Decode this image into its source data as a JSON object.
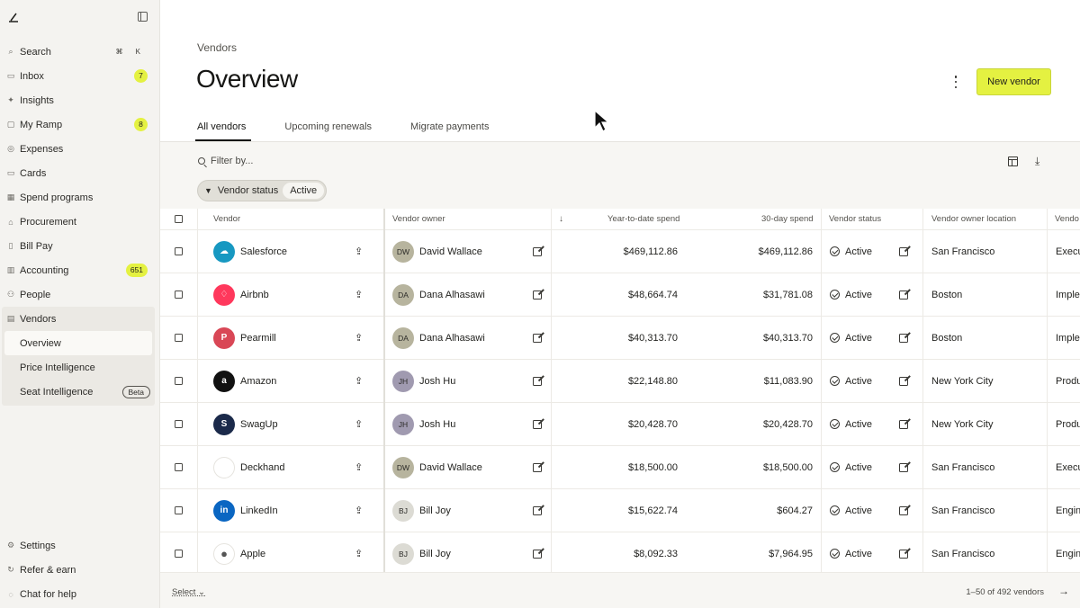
{
  "sidebar": {
    "items": [
      {
        "label": "Search",
        "icon": "search-icon",
        "shortcut": "⌘ K"
      },
      {
        "label": "Inbox",
        "icon": "inbox-icon",
        "badge": "7"
      },
      {
        "label": "Insights",
        "icon": "insights-icon"
      },
      {
        "label": "My Ramp",
        "icon": "my-ramp-icon",
        "badge": "8"
      },
      {
        "label": "Expenses",
        "icon": "expenses-icon"
      },
      {
        "label": "Cards",
        "icon": "cards-icon"
      },
      {
        "label": "Spend programs",
        "icon": "spend-programs-icon"
      },
      {
        "label": "Procurement",
        "icon": "procurement-icon"
      },
      {
        "label": "Bill Pay",
        "icon": "bill-pay-icon"
      },
      {
        "label": "Accounting",
        "icon": "accounting-icon",
        "badge": "651"
      },
      {
        "label": "People",
        "icon": "people-icon"
      }
    ],
    "vendors": {
      "label": "Vendors",
      "sub": [
        {
          "label": "Overview"
        },
        {
          "label": "Price Intelligence"
        },
        {
          "label": "Seat Intelligence",
          "tag": "Beta"
        }
      ]
    },
    "bottom": [
      {
        "label": "Settings",
        "icon": "gear-icon"
      },
      {
        "label": "Refer & earn",
        "icon": "refer-icon"
      },
      {
        "label": "Chat for help",
        "icon": "help-icon"
      }
    ]
  },
  "header": {
    "breadcrumb": "Vendors",
    "title": "Overview",
    "new_vendor": "New vendor"
  },
  "tabs": [
    "All vendors",
    "Upcoming renewals",
    "Migrate payments"
  ],
  "filter": {
    "placeholder": "Filter by...",
    "chip_label": "Vendor status",
    "chip_value": "Active"
  },
  "columns": {
    "vendor": "Vendor",
    "owner": "Vendor owner",
    "ytd": "Year-to-date spend",
    "spend30": "30-day spend",
    "status": "Vendor status",
    "location": "Vendor owner location",
    "extra": "Vendo"
  },
  "rows": [
    {
      "vendor": "Salesforce",
      "initials": "DW",
      "owner": "David Wallace",
      "ytd": "$469,112.86",
      "spend30": "$469,112.86",
      "status": "Active",
      "location": "San Francisco",
      "extra": "Execu",
      "logo": "salesforce",
      "avatar_color": "#b7b49e"
    },
    {
      "vendor": "Airbnb",
      "initials": "DA",
      "owner": "Dana Alhasawi",
      "ytd": "$48,664.74",
      "spend30": "$31,781.08",
      "status": "Active",
      "location": "Boston",
      "extra": "Imple",
      "logo": "airbnb",
      "avatar_color": "#b7b49e"
    },
    {
      "vendor": "Pearmill",
      "initials": "DA",
      "owner": "Dana Alhasawi",
      "ytd": "$40,313.70",
      "spend30": "$40,313.70",
      "status": "Active",
      "location": "Boston",
      "extra": "Imple",
      "logo": "pearmill",
      "avatar_color": "#b7b49e"
    },
    {
      "vendor": "Amazon",
      "initials": "JH",
      "owner": "Josh Hu",
      "ytd": "$22,148.80",
      "spend30": "$11,083.90",
      "status": "Active",
      "location": "New York City",
      "extra": "Produ",
      "logo": "amazon",
      "avatar_color": "#a09ab0"
    },
    {
      "vendor": "SwagUp",
      "initials": "JH",
      "owner": "Josh Hu",
      "ytd": "$20,428.70",
      "spend30": "$20,428.70",
      "status": "Active",
      "location": "New York City",
      "extra": "Produ",
      "logo": "swagup",
      "avatar_color": "#a09ab0"
    },
    {
      "vendor": "Deckhand",
      "initials": "DW",
      "owner": "David Wallace",
      "ytd": "$18,500.00",
      "spend30": "$18,500.00",
      "status": "Active",
      "location": "San Francisco",
      "extra": "Execu",
      "logo": "deckhand",
      "avatar_color": "#b7b49e"
    },
    {
      "vendor": "LinkedIn",
      "initials": "BJ",
      "owner": "Bill Joy",
      "ytd": "$15,622.74",
      "spend30": "$604.27",
      "status": "Active",
      "location": "San Francisco",
      "extra": "Engin",
      "logo": "linkedin",
      "avatar_color": "#dcdbd4"
    },
    {
      "vendor": "Apple",
      "initials": "BJ",
      "owner": "Bill Joy",
      "ytd": "$8,092.33",
      "spend30": "$7,964.95",
      "status": "Active",
      "location": "San Francisco",
      "extra": "Engin",
      "logo": "apple",
      "avatar_color": "#dcdbd4"
    }
  ],
  "footer": {
    "select": "Select",
    "pager": "1–50 of 492 vendors"
  },
  "colors": {
    "accent": "#e4f141",
    "sidebar_bg": "#f4f3f0"
  }
}
